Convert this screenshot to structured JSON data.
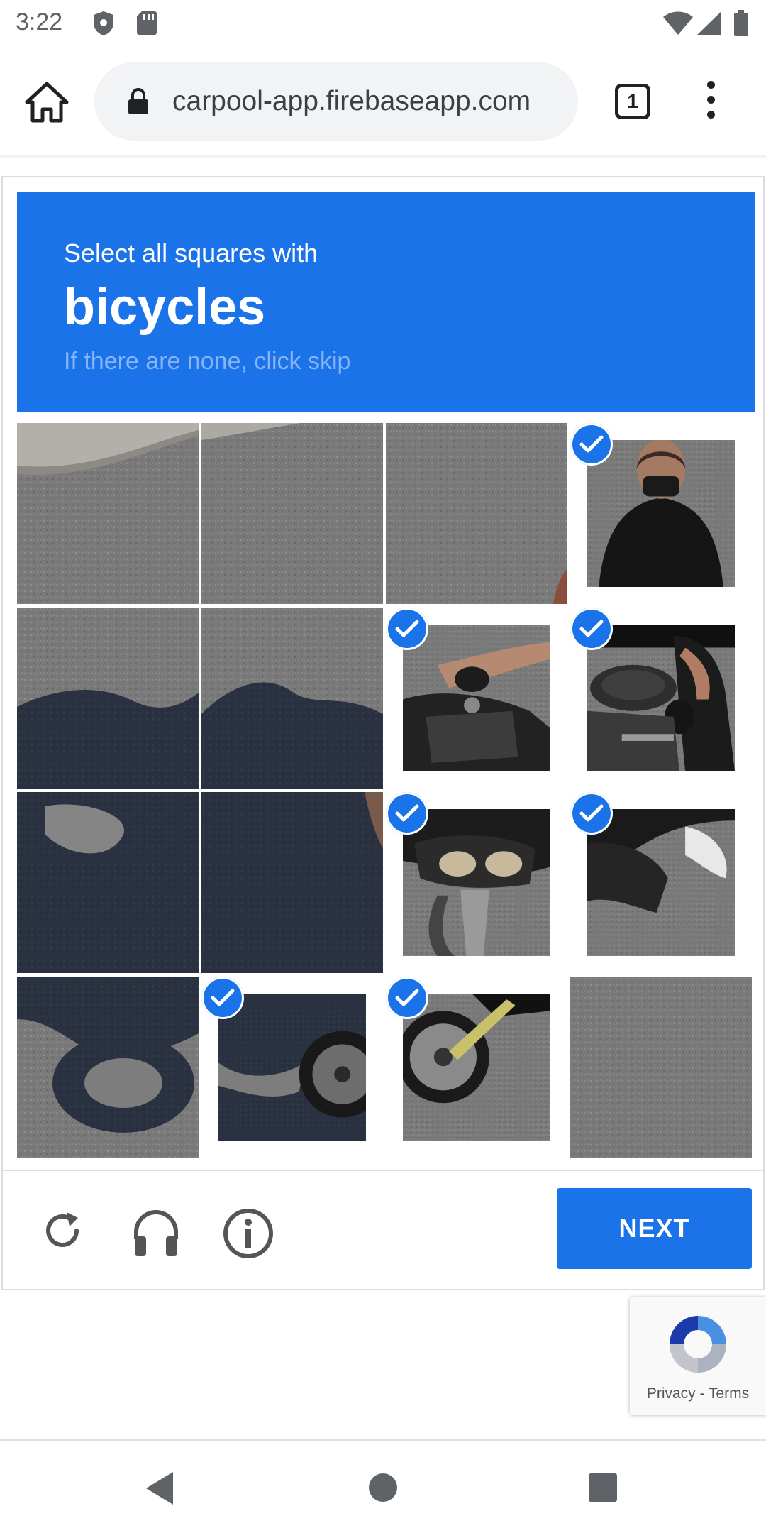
{
  "status_bar": {
    "time": "3:22",
    "icons": [
      "shield-icon",
      "sd-card-icon",
      "wifi-icon",
      "signal-icon",
      "battery-icon"
    ]
  },
  "browser": {
    "url": "carpool-app.firebaseapp.com",
    "tab_count": "1",
    "icons": [
      "home-icon",
      "lock-icon",
      "tabs-icon",
      "menu-icon"
    ]
  },
  "captcha": {
    "instruction": "Select all squares with",
    "target": "bicycles",
    "hint": "If there are none, click skip",
    "accent_color": "#1a73e8",
    "grid_columns": 4,
    "selected_tiles": [
      3,
      6,
      7,
      10,
      11,
      13,
      14
    ],
    "footer": {
      "reload_icon": "reload-icon",
      "audio_icon": "headphones-icon",
      "info_icon": "info-icon",
      "next_label": "NEXT"
    }
  },
  "recaptcha_badge": {
    "privacy": "Privacy",
    "separator": " - ",
    "terms": "Terms"
  },
  "nav_bar": {
    "icons": [
      "back-icon",
      "home-circle-icon",
      "recents-icon"
    ]
  }
}
